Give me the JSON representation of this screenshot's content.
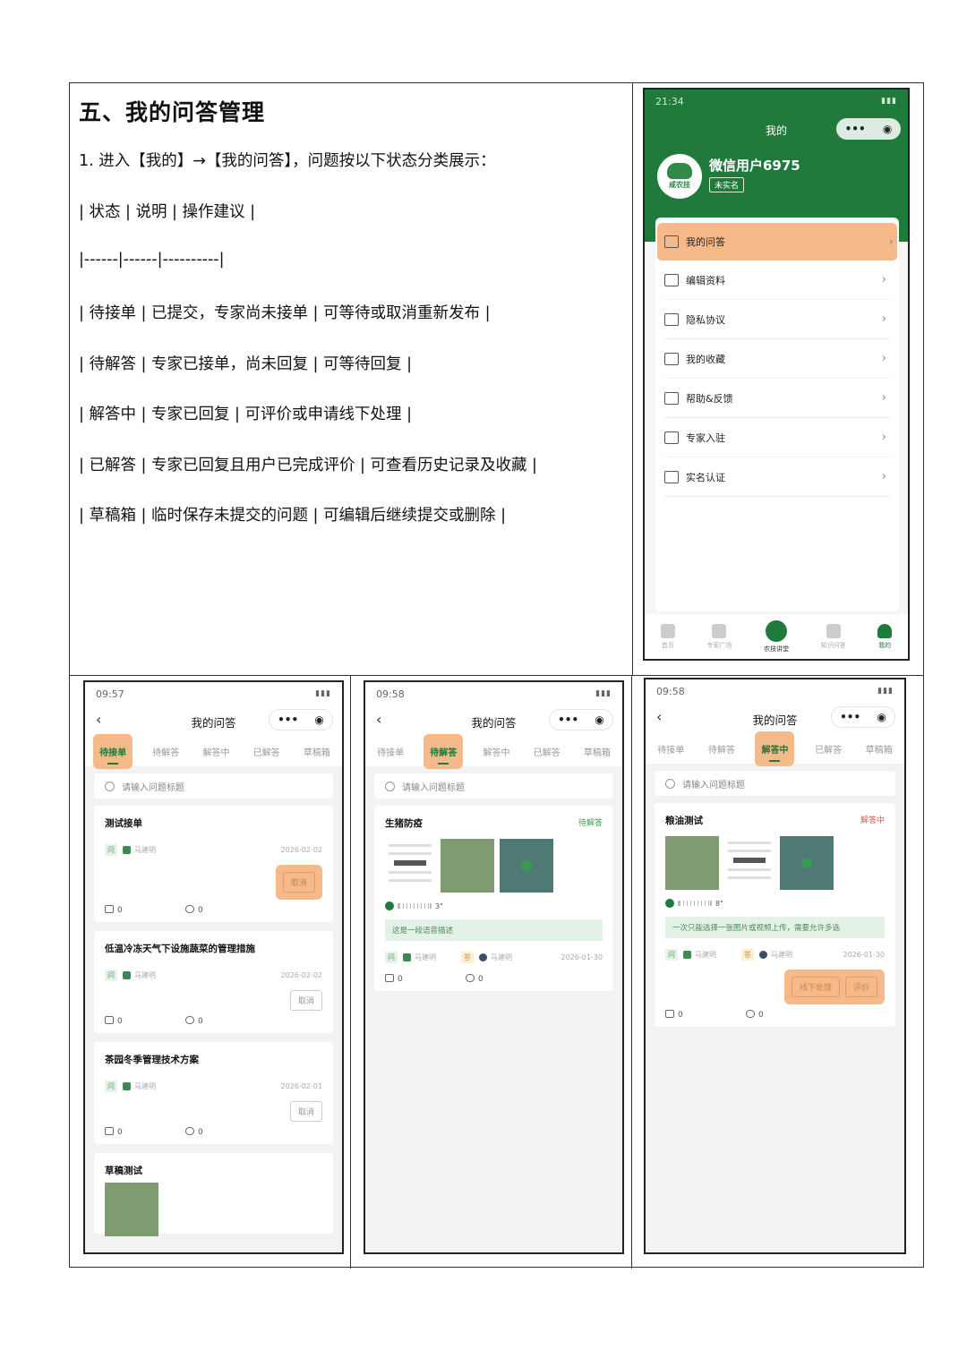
{
  "doc": {
    "heading": "五、我的问答管理",
    "lines": [
      "1. 进入【我的】→【我的问答】，问题按以下状态分类展示：",
      "| 状态 | 说明 | 操作建议 |",
      "|------|------|----------|",
      "| 待接单 | 已提交，专家尚未接单 | 可等待或取消重新发布 |",
      "| 待解答 | 专家已接单，尚未回复 | 可等待回复 |",
      "| 解答中 | 专家已回复 | 可评价或申请线下处理 |",
      "| 已解答 | 专家已回复且用户已完成评价 | 可查看历史记录及收藏 |",
      "| 草稿箱 | 临时保存未提交的问题 | 可编辑后继续提交或删除 |"
    ]
  },
  "profile": {
    "time": "21:34",
    "title": "我的",
    "brand": "咸农技",
    "username": "微信用户6975",
    "badge": "未实名",
    "menu": [
      {
        "label": "我的问答",
        "icon": "chat-icon"
      },
      {
        "label": "编辑资料",
        "icon": "edit-icon"
      },
      {
        "label": "隐私协议",
        "icon": "document-icon"
      },
      {
        "label": "我的收藏",
        "icon": "star-icon"
      },
      {
        "label": "帮助&反馈",
        "icon": "feedback-icon"
      },
      {
        "label": "专家入驻",
        "icon": "expert-icon"
      },
      {
        "label": "实名认证",
        "icon": "id-card-icon"
      }
    ],
    "tabbar": [
      "首页",
      "专家广场",
      "农技讲堂",
      "知识问答",
      "我的"
    ]
  },
  "common": {
    "page_title": "我的问答",
    "tabs": [
      "待接单",
      "待解答",
      "解答中",
      "已解答",
      "草稿箱"
    ],
    "search_placeholder": "请输入问题标题",
    "tag_q": "问",
    "tag_a": "答",
    "user": "马建明",
    "capsule_dots": "•••",
    "capsule_close": "◉",
    "chevron": "›",
    "back": "‹"
  },
  "phone1": {
    "time": "09:57",
    "cards": [
      {
        "title": "测试接单",
        "date": "2026-02-02",
        "btn": "取消",
        "likes": "0",
        "stars": "0"
      },
      {
        "title": "低温冷冻天气下设施蔬菜的管理措施",
        "date": "2026-02-02",
        "btn": "取消",
        "likes": "0",
        "stars": "0"
      },
      {
        "title": "茶园冬季管理技术方案",
        "date": "2026-02-01",
        "btn": "取消",
        "likes": "0",
        "stars": "0"
      },
      {
        "title": "草稿测试"
      }
    ]
  },
  "phone2": {
    "time": "09:58",
    "card": {
      "title": "生猪防疫",
      "status": "待解答",
      "duration": "3\"",
      "desc": "这是一段语音描述",
      "date": "2026-01-30",
      "likes": "0",
      "stars": "0"
    }
  },
  "phone3": {
    "time": "09:58",
    "card": {
      "title": "粮油测试",
      "status": "解答中",
      "duration": "8\"",
      "desc": "一次只能选择一张图片或视频上传，需要允许多选",
      "date": "2026-01-30",
      "btn_offline": "线下处理",
      "btn_rate": "评价",
      "likes": "0",
      "stars": "0"
    }
  },
  "colors": {
    "brand_green": "#1f7a3c",
    "highlight": "#f6b98a",
    "pending_red": "#e8534a",
    "answering_green": "#3c9a55"
  }
}
